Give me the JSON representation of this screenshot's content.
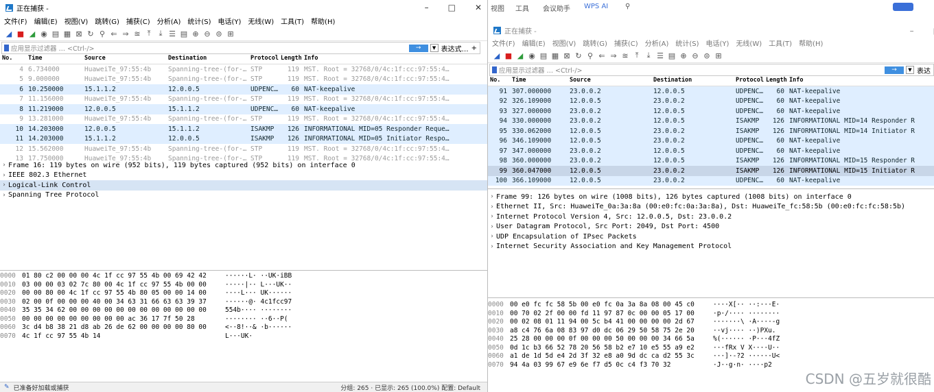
{
  "left": {
    "title": "正在捕获 -",
    "window_controls": [
      "–",
      "□",
      "✕"
    ],
    "menu": [
      "文件(F)",
      "编辑(E)",
      "视图(V)",
      "跳转(G)",
      "捕获(C)",
      "分析(A)",
      "统计(S)",
      "电话(Y)",
      "无线(W)",
      "工具(T)",
      "帮助(H)"
    ],
    "filter_placeholder": "应用显示过滤器 … <Ctrl-/>",
    "apply_label": "→",
    "expression_label": "表达式…",
    "plus_label": "+",
    "columns": [
      "No.",
      "Time",
      "Source",
      "Destination",
      "Protocol",
      "Length",
      "Info"
    ],
    "packets": [
      {
        "type": "stp",
        "no": "4",
        "time": "6.734000",
        "src": "HuaweiTe_97:55:4b",
        "dst": "Spanning-tree-(for-…",
        "proto": "STP",
        "len": "119",
        "info": "MST. Root = 32768/0/4c:1f:cc:97:55:4…"
      },
      {
        "type": "stp",
        "no": "5",
        "time": "9.000000",
        "src": "HuaweiTe_97:55:4b",
        "dst": "Spanning-tree-(for-…",
        "proto": "STP",
        "len": "119",
        "info": "MST. Root = 32768/0/4c:1f:cc:97:55:4…"
      },
      {
        "type": "udp",
        "no": "6",
        "time": "10.250000",
        "src": "15.1.1.2",
        "dst": "12.0.0.5",
        "proto": "UDPENC…",
        "len": "60",
        "info": "NAT-keepalive"
      },
      {
        "type": "stp",
        "no": "7",
        "time": "11.156000",
        "src": "HuaweiTe_97:55:4b",
        "dst": "Spanning-tree-(for-…",
        "proto": "STP",
        "len": "119",
        "info": "MST. Root = 32768/0/4c:1f:cc:97:55:4…"
      },
      {
        "type": "udp",
        "no": "8",
        "time": "11.219000",
        "src": "12.0.0.5",
        "dst": "15.1.1.2",
        "proto": "UDPENC…",
        "len": "60",
        "info": "NAT-keepalive"
      },
      {
        "type": "stp",
        "no": "9",
        "time": "13.281000",
        "src": "HuaweiTe_97:55:4b",
        "dst": "Spanning-tree-(for-…",
        "proto": "STP",
        "len": "119",
        "info": "MST. Root = 32768/0/4c:1f:cc:97:55:4…"
      },
      {
        "type": "isakmp",
        "no": "10",
        "time": "14.203000",
        "src": "12.0.0.5",
        "dst": "15.1.1.2",
        "proto": "ISAKMP",
        "len": "126",
        "info": "INFORMATIONAL MID=05 Responder Reque…"
      },
      {
        "type": "isakmp",
        "no": "11",
        "time": "14.203000",
        "src": "15.1.1.2",
        "dst": "12.0.0.5",
        "proto": "ISAKMP",
        "len": "126",
        "info": "INFORMATIONAL MID=05 Initiator Respo…"
      },
      {
        "type": "stp",
        "no": "12",
        "time": "15.562000",
        "src": "HuaweiTe_97:55:4b",
        "dst": "Spanning-tree-(for-…",
        "proto": "STP",
        "len": "119",
        "info": "MST. Root = 32768/0/4c:1f:cc:97:55:4…"
      },
      {
        "type": "stp",
        "no": "13",
        "time": "17.750000",
        "src": "HuaweiTe_97:55:4b",
        "dst": "Spanning-tree-(for-…",
        "proto": "STP",
        "len": "119",
        "info": "MST. Root = 32768/0/4c:1f:cc:97:55:4…"
      }
    ],
    "details": [
      "Frame 16: 119 bytes on wire (952 bits), 119 bytes captured (952 bits) on interface 0",
      "IEEE 802.3 Ethernet",
      "Logical-Link Control",
      "Spanning Tree Protocol"
    ],
    "selected_detail": 2,
    "hex": [
      {
        "off": "0000",
        "hex": "01 80 c2 00 00 00 4c 1f  cc 97 55 4b 00 69 42 42",
        "asc": "······L· ··UK·iBB"
      },
      {
        "off": "0010",
        "hex": "03 00 00 03 02 7c 80 00  4c 1f cc 97 55 4b 00 00",
        "asc": "·····|·· L···UK··"
      },
      {
        "off": "0020",
        "hex": "00 00 80 00 4c 1f cc 97  55 4b 80 05 00 00 14 00",
        "asc": "····L··· UK······"
      },
      {
        "off": "0030",
        "hex": "02 00 0f 00 00 00 40 00  34 63 31 66 63 63 39 37",
        "asc": "······@· 4c1fcc97"
      },
      {
        "off": "0040",
        "hex": "35 35 34 62 00 00 00 00  00 00 00 00 00 00 00 00",
        "asc": "554b···· ········"
      },
      {
        "off": "0050",
        "hex": "00 00 00 00 00 00 00 00  00 ac 36 17 7f 50 28",
        "asc": "········ ··6··P("
      },
      {
        "off": "0060",
        "hex": "3c d4 b8 38 21 d8 ab 26  de 62 00 00 00 00 80 00",
        "asc": "<··8!··& ·b······"
      },
      {
        "off": "0070",
        "hex": "4c 1f cc 97 55 4b 14",
        "asc": "L···UK·"
      }
    ],
    "status_left": "已准备好加载或捕获",
    "status_right": "分组: 265 · 已显示: 265 (100.0%)   配置: Default"
  },
  "right": {
    "title": "正在捕获 -",
    "window_controls": [
      "–",
      "□"
    ],
    "top_partial": [
      "视图",
      "工具",
      "会议助手",
      "WPS AI"
    ],
    "menu": [
      "文件(F)",
      "编辑(E)",
      "视图(V)",
      "跳转(G)",
      "捕获(C)",
      "分析(A)",
      "统计(S)",
      "电话(Y)",
      "无线(W)",
      "工具(T)",
      "帮助(H)"
    ],
    "filter_placeholder": "应用显示过滤器 … <Ctrl-/>",
    "apply_label": "→",
    "expression_label": "表达",
    "columns": [
      "No.",
      "Time",
      "Source",
      "Destination",
      "Protocol",
      "Length",
      "Info"
    ],
    "packets": [
      {
        "type": "udp",
        "no": "91",
        "time": "307.000000",
        "src": "23.0.0.2",
        "dst": "12.0.0.5",
        "proto": "UDPENC…",
        "len": "60",
        "info": "NAT-keepalive"
      },
      {
        "type": "udp",
        "no": "92",
        "time": "326.109000",
        "src": "12.0.0.5",
        "dst": "23.0.0.2",
        "proto": "UDPENC…",
        "len": "60",
        "info": "NAT-keepalive"
      },
      {
        "type": "udp",
        "no": "93",
        "time": "327.000000",
        "src": "23.0.0.2",
        "dst": "12.0.0.5",
        "proto": "UDPENC…",
        "len": "60",
        "info": "NAT-keepalive"
      },
      {
        "type": "isakmp",
        "no": "94",
        "time": "330.000000",
        "src": "23.0.0.2",
        "dst": "12.0.0.5",
        "proto": "ISAKMP",
        "len": "126",
        "info": "INFORMATIONAL MID=14 Responder R"
      },
      {
        "type": "isakmp",
        "no": "95",
        "time": "330.062000",
        "src": "12.0.0.5",
        "dst": "23.0.0.2",
        "proto": "ISAKMP",
        "len": "126",
        "info": "INFORMATIONAL MID=14 Initiator R"
      },
      {
        "type": "udp",
        "no": "96",
        "time": "346.109000",
        "src": "12.0.0.5",
        "dst": "23.0.0.2",
        "proto": "UDPENC…",
        "len": "60",
        "info": "NAT-keepalive"
      },
      {
        "type": "udp",
        "no": "97",
        "time": "347.000000",
        "src": "23.0.0.2",
        "dst": "12.0.0.5",
        "proto": "UDPENC…",
        "len": "60",
        "info": "NAT-keepalive"
      },
      {
        "type": "isakmp",
        "no": "98",
        "time": "360.000000",
        "src": "23.0.0.2",
        "dst": "12.0.0.5",
        "proto": "ISAKMP",
        "len": "126",
        "info": "INFORMATIONAL MID=15 Responder R"
      },
      {
        "type": "sel",
        "no": "99",
        "time": "360.047000",
        "src": "12.0.0.5",
        "dst": "23.0.0.2",
        "proto": "ISAKMP",
        "len": "126",
        "info": "INFORMATIONAL MID=15 Initiator R"
      },
      {
        "type": "udp",
        "no": "100",
        "time": "366.109000",
        "src": "12.0.0.5",
        "dst": "23.0.0.2",
        "proto": "UDPENC…",
        "len": "60",
        "info": "NAT-keepalive"
      }
    ],
    "details": [
      "Frame 99: 126 bytes on wire (1008 bits), 126 bytes captured (1008 bits) on interface 0",
      "Ethernet II, Src: HuaweiTe_0a:3a:8a (00:e0:fc:0a:3a:8a), Dst: HuaweiTe_fc:58:5b (00:e0:fc:fc:58:5b)",
      "Internet Protocol Version 4, Src: 12.0.0.5, Dst: 23.0.0.2",
      "User Datagram Protocol, Src Port: 2049, Dst Port: 4500",
      "UDP Encapsulation of IPsec Packets",
      "Internet Security Association and Key Management Protocol"
    ],
    "hex": [
      {
        "off": "0000",
        "hex": "00 e0 fc fc 58 5b 00 e0  fc 0a 3a 8a 08 00 45 c0",
        "asc": "····X[·· ··:···E·"
      },
      {
        "off": "0010",
        "hex": "00 70 02 2f 00 00 fd 11  97 87 0c 00 00 05 17 00",
        "asc": "·p·/···· ········"
      },
      {
        "off": "0020",
        "hex": "00 02 08 01 11 94 00 5c  b4 41 00 00 00 00 2d 67",
        "asc": "·······\\ ·A····-g"
      },
      {
        "off": "0030",
        "hex": "a8 c4 76 6a 08 83 97 d0  dc 06 29 50 58 75 2e 20",
        "asc": "··vj···· ··)PXu. "
      },
      {
        "off": "0040",
        "hex": "25 28 00 00 00 0f 00 00  00 50 00 00 00 34 66 5a",
        "asc": "%(······ ·P···4fZ"
      },
      {
        "off": "0050",
        "hex": "0d 1c b3 66 52 78 20 56  58 b2 e7 10 e5 55 a9 e2",
        "asc": "···fRx V X····U··"
      },
      {
        "off": "0060",
        "hex": "a1 de 1d 5d e4 2d 3f 32  e8 a0 9d dc ca d2 55 3c",
        "asc": "···]·-?2 ······U<"
      },
      {
        "off": "0070",
        "hex": "94 4a 03 99 67 e9 6e f7  d5 0c c4 f3 70 32",
        "asc": "·J··g·n· ····p2"
      }
    ]
  },
  "watermark": "CSDN @五岁就很酷",
  "colors": {
    "row_blue": "#dfeeff",
    "row_selected": "#c8d6e8",
    "stp_text": "#9a9a9a",
    "accent": "#3f8fe0",
    "stop": "#d81e1e",
    "shark": "#2e9b3b"
  }
}
